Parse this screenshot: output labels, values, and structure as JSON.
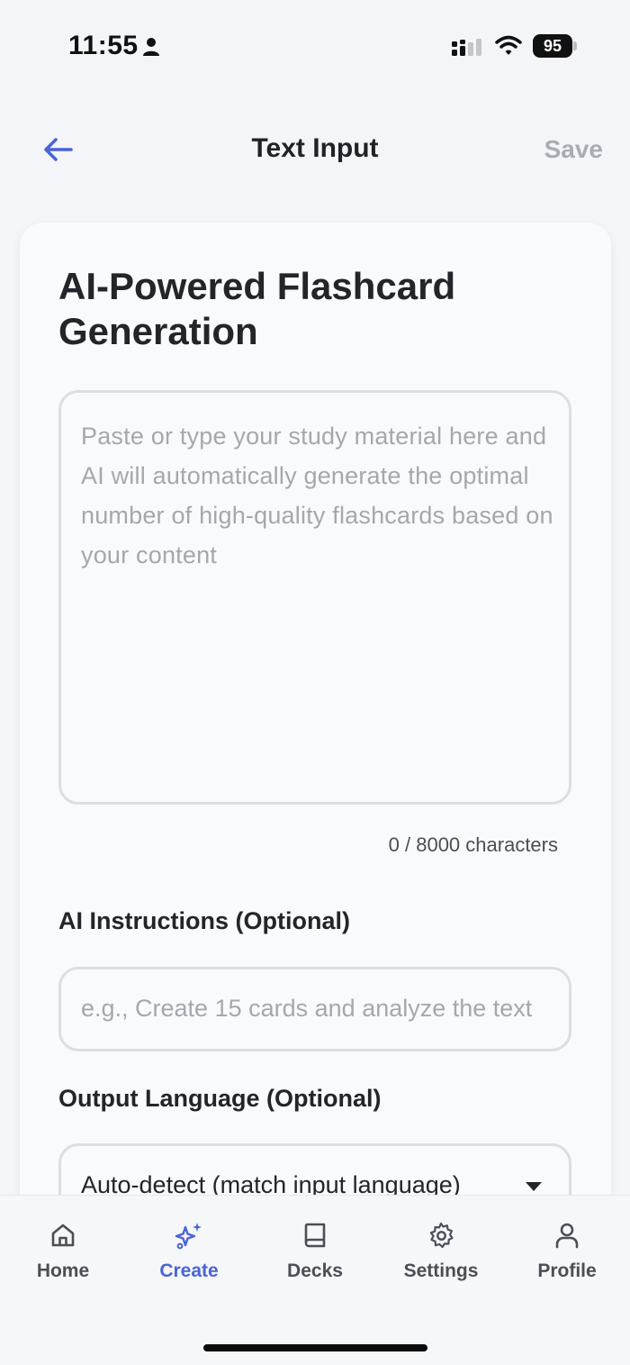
{
  "status_bar": {
    "time": "11:55",
    "battery": "95"
  },
  "header": {
    "title": "Text Input",
    "save_label": "Save",
    "back_icon": "arrow-left-icon"
  },
  "form": {
    "title": "AI-Powered Flashcard Generation",
    "study_material": {
      "value": "",
      "placeholder": "Paste or type your study material here and AI will automatically generate the optimal number of high-quality flashcards based on your content",
      "char_count_label": "0 / 8000 characters"
    },
    "instructions": {
      "label": "AI Instructions (Optional)",
      "value": "",
      "placeholder": "e.g., Create 15 cards and analyze the text"
    },
    "language": {
      "label": "Output Language (Optional)",
      "selected": "Auto-detect (match input language)"
    }
  },
  "tab_bar": {
    "items": [
      {
        "label": "Home",
        "icon": "home-icon"
      },
      {
        "label": "Create",
        "icon": "sparkles-icon",
        "active": true
      },
      {
        "label": "Decks",
        "icon": "book-icon"
      },
      {
        "label": "Settings",
        "icon": "gear-icon"
      },
      {
        "label": "Profile",
        "icon": "user-icon"
      }
    ]
  },
  "colors": {
    "accent": "#4a63d8",
    "background": "#f4f5f8",
    "muted_text": "#a4a8ae"
  }
}
